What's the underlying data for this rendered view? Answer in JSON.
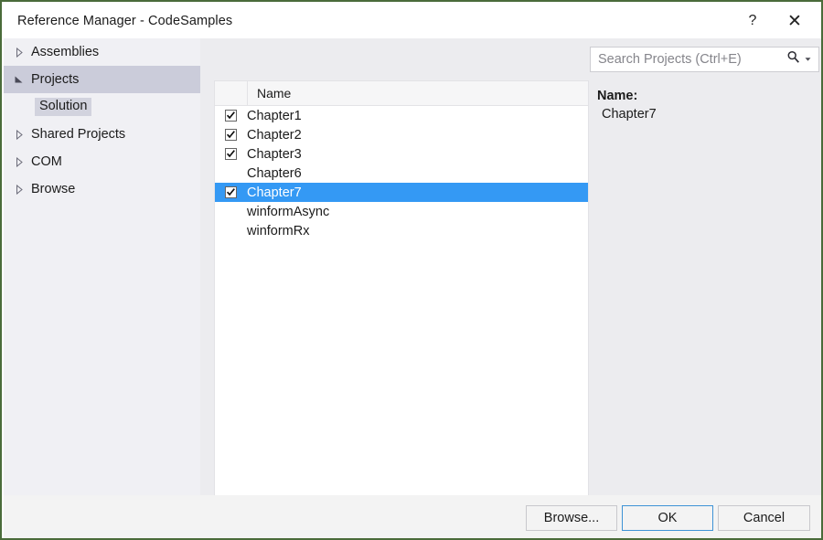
{
  "window": {
    "title": "Reference Manager - CodeSamples",
    "help_icon": "question-mark-icon",
    "help_glyph": "?",
    "close_icon": "close-icon",
    "close_glyph": "✕"
  },
  "sidebar": {
    "items": [
      {
        "label": "Assemblies",
        "state": "collapsed",
        "selected": false
      },
      {
        "label": "Projects",
        "state": "expanded",
        "selected": true
      },
      {
        "label": "Shared Projects",
        "state": "collapsed",
        "selected": false
      },
      {
        "label": "COM",
        "state": "collapsed",
        "selected": false
      },
      {
        "label": "Browse",
        "state": "collapsed",
        "selected": false
      }
    ],
    "child": {
      "label": "Solution",
      "selected": true
    }
  },
  "list": {
    "columns": [
      "",
      "Name"
    ],
    "header_name": "Name",
    "rows": [
      {
        "name": "Chapter1",
        "checked": true,
        "selected": false
      },
      {
        "name": "Chapter2",
        "checked": true,
        "selected": false
      },
      {
        "name": "Chapter3",
        "checked": true,
        "selected": false
      },
      {
        "name": "Chapter6",
        "checked": false,
        "selected": false
      },
      {
        "name": "Chapter7",
        "checked": true,
        "selected": true
      },
      {
        "name": "winformAsync",
        "checked": false,
        "selected": false
      },
      {
        "name": "winformRx",
        "checked": false,
        "selected": false
      }
    ],
    "scrollbar": {
      "left_arrow_icon": "triangle-left-icon",
      "right_arrow_icon": "triangle-right-icon",
      "thumb_percent": 46
    }
  },
  "search": {
    "placeholder": "Search Projects (Ctrl+E)",
    "value": "",
    "search_icon": "search-icon",
    "dropdown_icon": "chevron-down-icon"
  },
  "details": {
    "name_label": "Name:",
    "name_value": "Chapter7"
  },
  "footer": {
    "browse_label": "Browse...",
    "ok_label": "OK",
    "cancel_label": "Cancel"
  },
  "colors": {
    "selection_blue": "#3499f4",
    "tree_selection": "#cbccda",
    "body_bg": "#ececef",
    "sidebar_bg": "#f0f0f4",
    "footer_bg": "#f3f3f3",
    "default_button_border": "#3e93d6"
  }
}
